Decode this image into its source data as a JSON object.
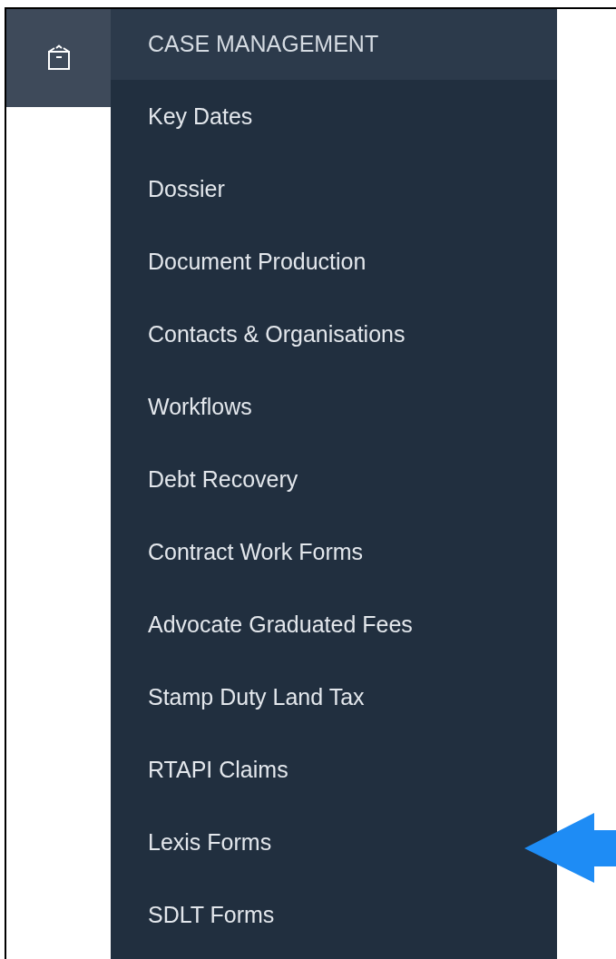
{
  "menu": {
    "header": "CASE MANAGEMENT",
    "items": [
      {
        "label": "Key Dates"
      },
      {
        "label": "Dossier"
      },
      {
        "label": "Document Production"
      },
      {
        "label": "Contacts & Organisations"
      },
      {
        "label": "Workflows"
      },
      {
        "label": "Debt Recovery"
      },
      {
        "label": "Contract Work Forms"
      },
      {
        "label": "Advocate Graduated Fees"
      },
      {
        "label": "Stamp Duty Land Tax"
      },
      {
        "label": "RTAPI Claims"
      },
      {
        "label": "Lexis Forms"
      },
      {
        "label": "SDLT Forms"
      }
    ]
  }
}
